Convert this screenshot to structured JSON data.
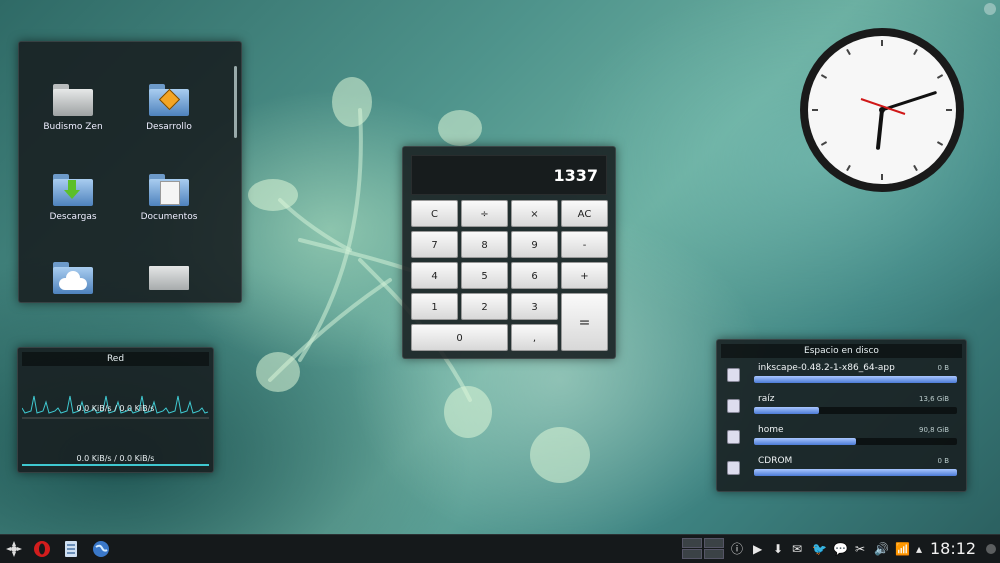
{
  "folder_view": {
    "items": [
      {
        "label": "Budismo Zen",
        "icon": "folder-icon"
      },
      {
        "label": "Desarrollo",
        "icon": "folder-development-icon"
      },
      {
        "label": "Descargas",
        "icon": "folder-downloads-icon"
      },
      {
        "label": "Documentos",
        "icon": "folder-documents-icon"
      },
      {
        "label": "",
        "icon": "folder-cloud-icon"
      },
      {
        "label": "",
        "icon": "image-file-icon"
      }
    ]
  },
  "network": {
    "title": "Red",
    "rate_top": "0.0 KiB/s / 0.0 KiB/s",
    "rate_bottom": "0.0 KiB/s / 0.0 KiB/s"
  },
  "calculator": {
    "display": "1337",
    "buttons": {
      "c": "C",
      "div": "÷",
      "mul": "×",
      "ac": "AC",
      "n7": "7",
      "n8": "8",
      "n9": "9",
      "minus": "-",
      "n4": "4",
      "n5": "5",
      "n6": "6",
      "plus": "+",
      "n1": "1",
      "n2": "2",
      "n3": "3",
      "equals": "=",
      "n0": "0",
      "dot": ","
    }
  },
  "analog_clock": {
    "hour": 6,
    "minute": 12
  },
  "disk_space": {
    "title": "Espacio en disco",
    "devices": [
      {
        "name": "inkscape-0.48.2-1-x86_64-app",
        "size": "0 B",
        "fill": 1.0
      },
      {
        "name": "raíz",
        "size": "13,6 GiB",
        "fill": 0.32
      },
      {
        "name": "home",
        "size": "90,8 GiB",
        "fill": 0.5
      },
      {
        "name": "CDROM",
        "size": "0 B",
        "fill": 1.0
      }
    ]
  },
  "taskbar": {
    "launchers": [
      "kde-menu-icon",
      "opera-icon",
      "file-manager-icon",
      "web-browser-icon"
    ],
    "tray": [
      "info-icon",
      "play-icon",
      "download-icon",
      "mail-icon",
      "twitter-icon",
      "chat-icon",
      "scissors-icon",
      "volume-icon",
      "wifi-icon",
      "expand-icon"
    ],
    "time": "18:12"
  },
  "colors": {
    "accent_blue": "#4c7bd6",
    "graph_cyan": "#3fc8d0",
    "clock_second_hand": "#d01818"
  }
}
